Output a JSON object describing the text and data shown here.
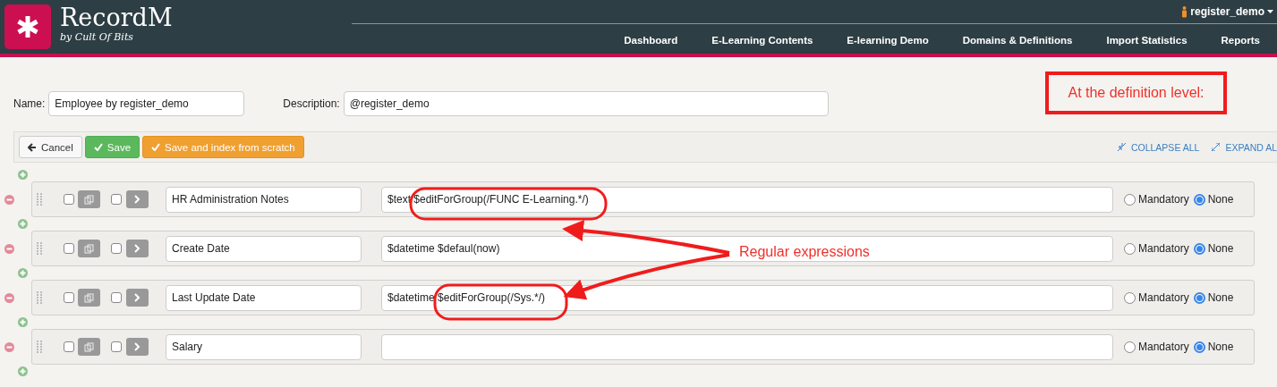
{
  "header": {
    "logo_text": "RecordM",
    "logo_subtitle": "by Cult Of Bits",
    "user": "register_demo",
    "nav": [
      "Dashboard",
      "E-Learning Contents",
      "E-learning Demo",
      "Domains & Definitions",
      "Import Statistics",
      "Reports"
    ]
  },
  "form": {
    "name_label": "Name:",
    "name_value": "Employee by register_demo",
    "description_label": "Description:",
    "description_value": "@register_demo"
  },
  "toolbar": {
    "buttons": [
      {
        "kind": "back",
        "label": "Cancel"
      },
      {
        "kind": "success",
        "label": "Save"
      },
      {
        "kind": "warning",
        "label": "Save and index from scratch"
      }
    ],
    "collapse": "COLLAPSE ALL",
    "expand": "EXPAND AL"
  },
  "rows": [
    {
      "name": "HR Administration Notes",
      "definition": "$text $editForGroup(/FUNC E-Learning.*/)",
      "checked_a": false,
      "checked_b": false,
      "options": [
        {
          "label": "Mandatory",
          "selected": false
        },
        {
          "label": "None",
          "selected": true
        }
      ]
    },
    {
      "name": "Create Date",
      "definition": "$datetime $defaul(now)",
      "checked_a": false,
      "checked_b": false,
      "options": [
        {
          "label": "Mandatory",
          "selected": false
        },
        {
          "label": "None",
          "selected": true
        }
      ]
    },
    {
      "name": "Last Update Date",
      "definition": "$datetime $editForGroup(/Sys.*/)",
      "checked_a": false,
      "checked_b": false,
      "options": [
        {
          "label": "Mandatory",
          "selected": false
        },
        {
          "label": "None",
          "selected": true
        }
      ]
    },
    {
      "name": "Salary",
      "checked_a": false,
      "checked_b": false,
      "options": [
        {
          "label": "Mandatory",
          "selected": false
        },
        {
          "label": "None",
          "selected": true
        }
      ]
    }
  ],
  "annotations": {
    "note": "At the definition level:",
    "callout": "Regular expressions"
  }
}
